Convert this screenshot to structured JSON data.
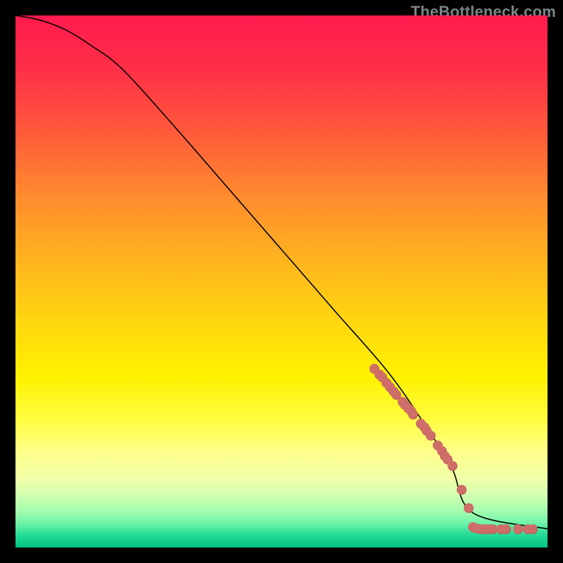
{
  "watermark": "TheBottleneck.com",
  "colors": {
    "dot": "#cf6d69",
    "curve": "#000000"
  },
  "chart_data": {
    "type": "line",
    "title": "",
    "xlabel": "",
    "ylabel": "",
    "xlim": [
      0,
      100
    ],
    "ylim": [
      0,
      100
    ],
    "series": [
      {
        "name": "curve",
        "kind": "line",
        "x": [
          0,
          3,
          6,
          10,
          14,
          20,
          30,
          40,
          50,
          60,
          70,
          77,
          82,
          86,
          100
        ],
        "y": [
          100,
          99.5,
          98.7,
          97.0,
          94.5,
          90.0,
          79.0,
          67.5,
          56.0,
          44.5,
          33.0,
          23.0,
          15.0,
          6.5,
          3.5
        ]
      },
      {
        "name": "dots",
        "kind": "scatter",
        "x": [
          67.5,
          68.4,
          68.9,
          69.7,
          70.4,
          71.0,
          71.6,
          72.7,
          73.2,
          73.8,
          74.3,
          74.8,
          76.2,
          76.8,
          77.3,
          78.0,
          79.3,
          80.1,
          80.7,
          81.2,
          82.2,
          83.9,
          85.2,
          86.0,
          86.7,
          87.4,
          88.1,
          88.9,
          89.7,
          91.3,
          92.2,
          94.5,
          96.3,
          97.2
        ],
        "y": [
          33.6,
          32.6,
          32.0,
          31.0,
          30.1,
          29.4,
          28.7,
          27.4,
          26.8,
          26.2,
          25.6,
          25.0,
          23.3,
          22.6,
          21.9,
          21.0,
          19.2,
          18.1,
          17.2,
          16.5,
          15.3,
          10.8,
          7.4,
          3.8,
          3.6,
          3.5,
          3.5,
          3.5,
          3.5,
          3.5,
          3.5,
          3.5,
          3.5,
          3.5
        ]
      }
    ]
  }
}
